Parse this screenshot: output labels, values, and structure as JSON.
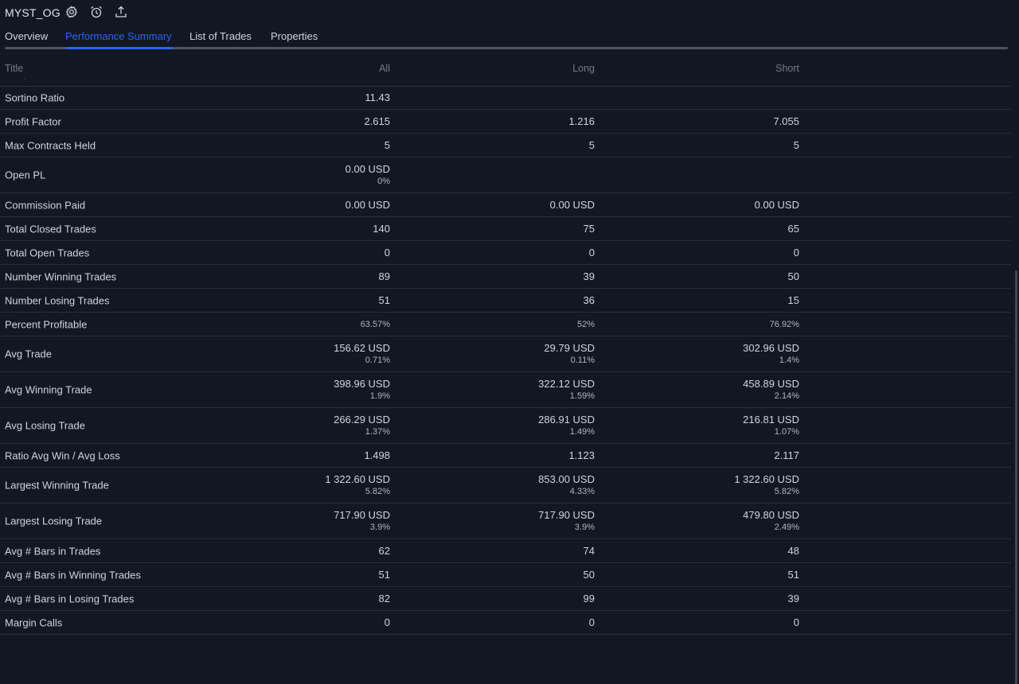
{
  "topbar": {
    "strategy_name": "MYST_OG",
    "icons": [
      "gear-icon",
      "alarm-clock-icon",
      "export-icon"
    ]
  },
  "tabs": [
    {
      "label": "Overview",
      "active": false
    },
    {
      "label": "Performance Summary",
      "active": true
    },
    {
      "label": "List of Trades",
      "active": false
    },
    {
      "label": "Properties",
      "active": false
    }
  ],
  "table": {
    "headers": {
      "title": "Title",
      "all": "All",
      "long": "Long",
      "short": "Short"
    },
    "rows": [
      {
        "title": "Sortino Ratio",
        "all": "11.43",
        "all_sub": "",
        "long": "",
        "long_sub": "",
        "short": "",
        "short_sub": ""
      },
      {
        "title": "Profit Factor",
        "all": "2.615",
        "all_sub": "",
        "long": "1.216",
        "long_sub": "",
        "short": "7.055",
        "short_sub": ""
      },
      {
        "title": "Max Contracts Held",
        "all": "5",
        "all_sub": "",
        "long": "5",
        "long_sub": "",
        "short": "5",
        "short_sub": ""
      },
      {
        "title": "Open PL",
        "all": "0.00 USD",
        "all_sub": "0%",
        "long": "",
        "long_sub": "",
        "short": "",
        "short_sub": ""
      },
      {
        "title": "Commission Paid",
        "all": "0.00 USD",
        "all_sub": "",
        "long": "0.00 USD",
        "long_sub": "",
        "short": "0.00 USD",
        "short_sub": ""
      },
      {
        "title": "Total Closed Trades",
        "all": "140",
        "all_sub": "",
        "long": "75",
        "long_sub": "",
        "short": "65",
        "short_sub": ""
      },
      {
        "title": "Total Open Trades",
        "all": "0",
        "all_sub": "",
        "long": "0",
        "long_sub": "",
        "short": "0",
        "short_sub": ""
      },
      {
        "title": "Number Winning Trades",
        "all": "89",
        "all_sub": "",
        "long": "39",
        "long_sub": "",
        "short": "50",
        "short_sub": ""
      },
      {
        "title": "Number Losing Trades",
        "all": "51",
        "all_sub": "",
        "long": "36",
        "long_sub": "",
        "short": "15",
        "short_sub": ""
      },
      {
        "title": "Percent Profitable",
        "all": "63.57%",
        "all_sub": "",
        "long": "52%",
        "long_sub": "",
        "short": "76.92%",
        "short_sub": "",
        "small": true
      },
      {
        "title": "Avg Trade",
        "all": "156.62 USD",
        "all_sub": "0.71%",
        "long": "29.79 USD",
        "long_sub": "0.11%",
        "short": "302.96 USD",
        "short_sub": "1.4%"
      },
      {
        "title": "Avg Winning Trade",
        "all": "398.96 USD",
        "all_sub": "1.9%",
        "long": "322.12 USD",
        "long_sub": "1.59%",
        "short": "458.89 USD",
        "short_sub": "2.14%"
      },
      {
        "title": "Avg Losing Trade",
        "all": "266.29 USD",
        "all_sub": "1.37%",
        "long": "286.91 USD",
        "long_sub": "1.49%",
        "short": "216.81 USD",
        "short_sub": "1.07%"
      },
      {
        "title": "Ratio Avg Win / Avg Loss",
        "all": "1.498",
        "all_sub": "",
        "long": "1.123",
        "long_sub": "",
        "short": "2.117",
        "short_sub": ""
      },
      {
        "title": "Largest Winning Trade",
        "all": "1 322.60 USD",
        "all_sub": "5.82%",
        "long": "853.00 USD",
        "long_sub": "4.33%",
        "short": "1 322.60 USD",
        "short_sub": "5.82%"
      },
      {
        "title": "Largest Losing Trade",
        "all": "717.90 USD",
        "all_sub": "3.9%",
        "long": "717.90 USD",
        "long_sub": "3.9%",
        "short": "479.80 USD",
        "short_sub": "2.49%"
      },
      {
        "title": "Avg # Bars in Trades",
        "all": "62",
        "all_sub": "",
        "long": "74",
        "long_sub": "",
        "short": "48",
        "short_sub": ""
      },
      {
        "title": "Avg # Bars in Winning Trades",
        "all": "51",
        "all_sub": "",
        "long": "50",
        "long_sub": "",
        "short": "51",
        "short_sub": ""
      },
      {
        "title": "Avg # Bars in Losing Trades",
        "all": "82",
        "all_sub": "",
        "long": "99",
        "long_sub": "",
        "short": "39",
        "short_sub": ""
      },
      {
        "title": "Margin Calls",
        "all": "0",
        "all_sub": "",
        "long": "0",
        "long_sub": "",
        "short": "0",
        "short_sub": ""
      }
    ]
  },
  "colors": {
    "background": "#131722",
    "text": "#d1d4dc",
    "muted": "#787b86",
    "accent": "#2962ff",
    "divider": "#2a2e39"
  }
}
